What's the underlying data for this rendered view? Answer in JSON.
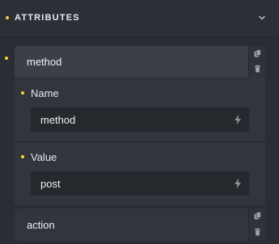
{
  "section": {
    "title": "ATTRIBUTES",
    "toggle_icon": "chevron-down-icon"
  },
  "items": [
    {
      "label": "method",
      "fields": [
        {
          "label": "Name",
          "value": "method",
          "icon": "dynamic-data-bolt-icon"
        },
        {
          "label": "Value",
          "value": "post",
          "icon": "dynamic-data-bolt-icon"
        }
      ],
      "actions": [
        "duplicate-icon",
        "delete-icon"
      ]
    },
    {
      "label": "action",
      "actions": [
        "duplicate-icon",
        "delete-icon"
      ]
    }
  ],
  "colors": {
    "indicator": "#f5d442",
    "background": "#2a2d33",
    "panel": "#32353c",
    "item_header": "#3b3f47",
    "input": "#25282d"
  }
}
